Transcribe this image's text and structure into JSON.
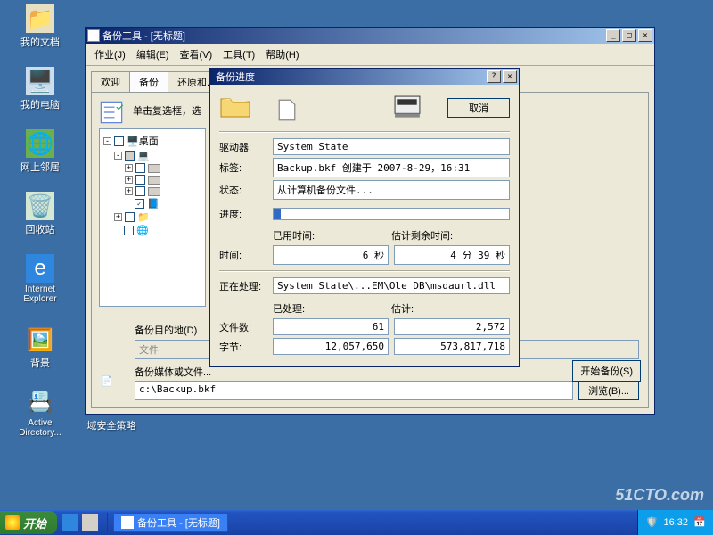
{
  "desktop_icons": [
    {
      "label": "我的文档",
      "key": "my-documents"
    },
    {
      "label": "我的电脑",
      "key": "my-computer"
    },
    {
      "label": "网上邻居",
      "key": "network-places"
    },
    {
      "label": "回收站",
      "key": "recycle-bin"
    },
    {
      "label": "Internet Explorer",
      "key": "ie"
    },
    {
      "label": "背景",
      "key": "background"
    },
    {
      "label": "Active Directory...",
      "key": "active-directory"
    },
    {
      "label": "域安全策略",
      "key": "domain-policy"
    }
  ],
  "backup_window": {
    "title": "备份工具 - [无标题]",
    "menu": [
      "作业(J)",
      "编辑(E)",
      "查看(V)",
      "工具(T)",
      "帮助(H)"
    ],
    "tabs": [
      "欢迎",
      "备份",
      "还原和..."
    ],
    "active_tab": 1,
    "instruction": "单击复选框，选",
    "tree": {
      "root": "桌面"
    },
    "dest_group": "备份目的地(D)",
    "dest_value": "文件",
    "media_label": "备份媒体或文件...",
    "media_value": "c:\\Backup.bkf",
    "browse": "浏览(B)...",
    "start_backup": "开始备份(S)"
  },
  "progress_dialog": {
    "title": "备份进度",
    "cancel": "取消",
    "labels": {
      "drive": "驱动器:",
      "tag": "标签:",
      "status": "状态:",
      "progress": "进度:",
      "time": "时间:",
      "processing": "正在处理:",
      "elapsed": "已用时间:",
      "remaining": "估计剩余时间:",
      "processed": "已处理:",
      "estimated": "估计:",
      "files": "文件数:",
      "bytes": "字节:"
    },
    "values": {
      "drive": "System State",
      "tag": "Backup.bkf 创建于 2007-8-29，16:31",
      "status": "从计算机备份文件...",
      "elapsed": "6 秒",
      "remaining": "4 分 39 秒",
      "processing": "System State\\...EM\\Ole DB\\msdaurl.dll",
      "files_done": "61",
      "files_est": "2,572",
      "bytes_done": "12,057,650",
      "bytes_est": "573,817,718"
    },
    "progress_pct": 3
  },
  "taskbar": {
    "start": "开始",
    "task": "备份工具 - [无标题]",
    "time": "16:32"
  },
  "watermark": "51CTO.com"
}
